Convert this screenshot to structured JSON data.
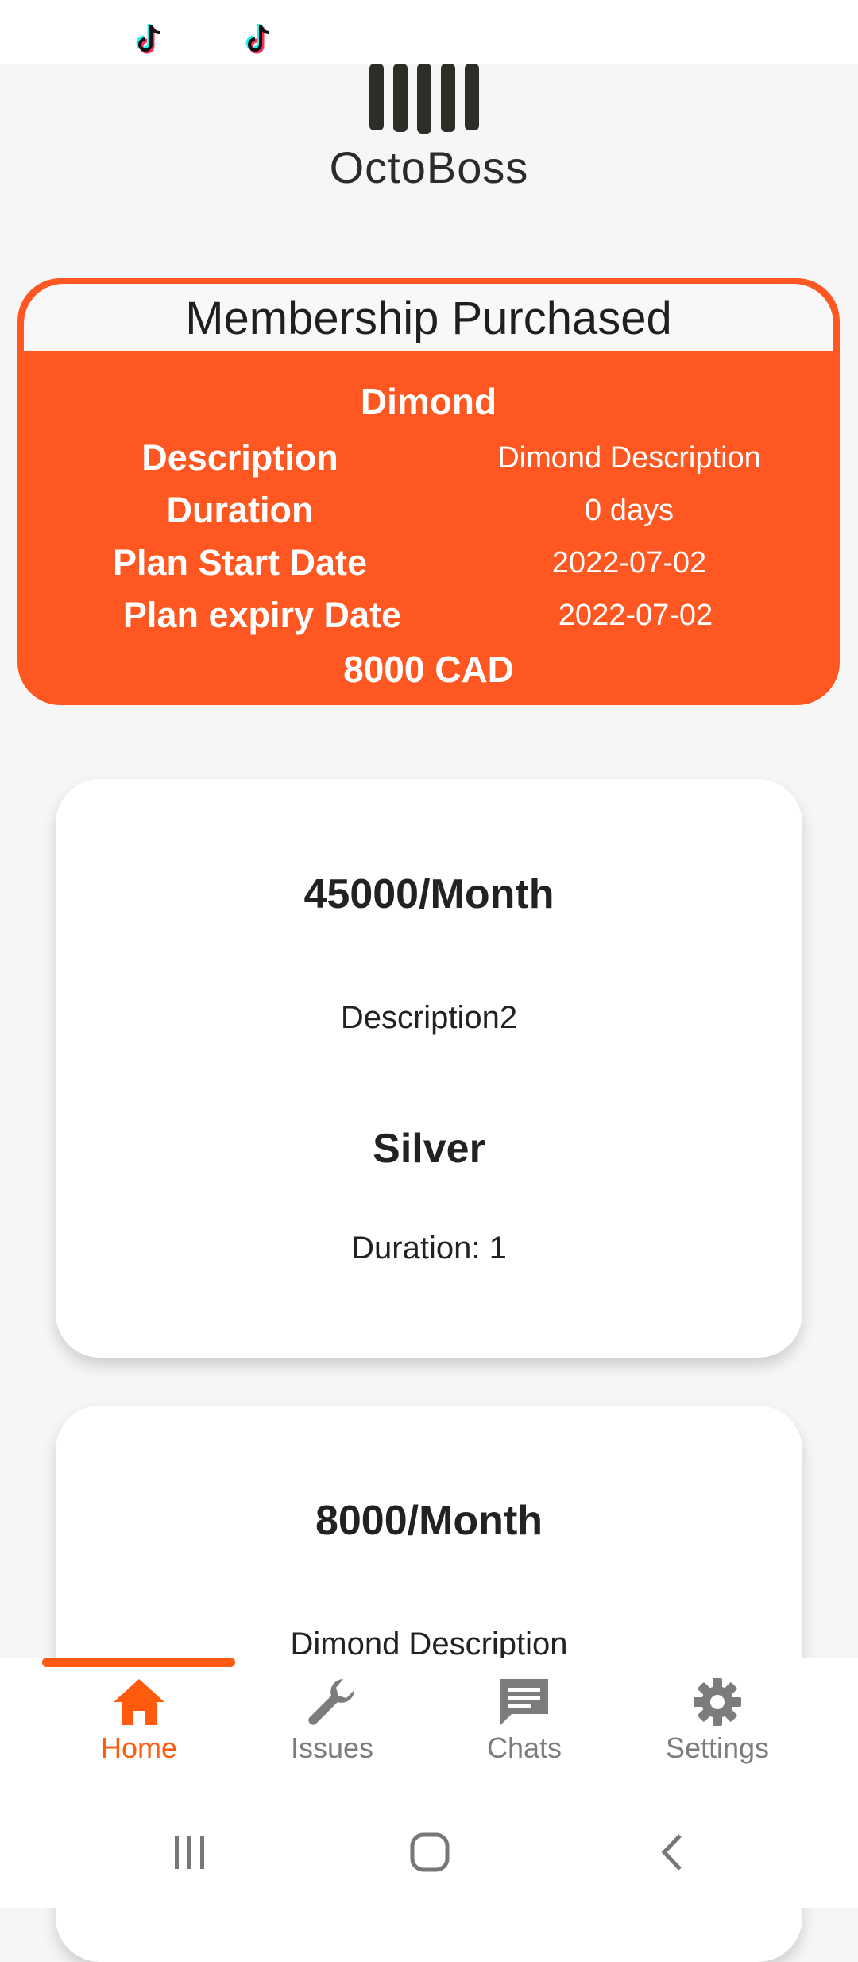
{
  "app": {
    "name": "OctoBoss"
  },
  "status_bar": {
    "icons": [
      "tiktok-icon",
      "tiktok-icon"
    ]
  },
  "membership": {
    "title": "Membership Purchased",
    "plan_name": "Dimond",
    "rows": [
      {
        "label": "Description",
        "value": "Dimond Description"
      },
      {
        "label": "Duration",
        "value": "0 days"
      },
      {
        "label": "Plan Start Date",
        "value": "2022-07-02"
      },
      {
        "label": "Plan expiry Date",
        "value": "2022-07-02"
      }
    ],
    "price": "8000 CAD"
  },
  "plans": [
    {
      "price": "45000/Month",
      "description": "Description2",
      "tier": "Silver",
      "duration": "Duration: 1"
    },
    {
      "price": "8000/Month",
      "description": "Dimond Description"
    }
  ],
  "bottom_nav": {
    "items": [
      {
        "label": "Home",
        "icon": "home-icon",
        "active": true
      },
      {
        "label": "Issues",
        "icon": "wrench-icon",
        "active": false
      },
      {
        "label": "Chats",
        "icon": "chat-icon",
        "active": false
      },
      {
        "label": "Settings",
        "icon": "gear-icon",
        "active": false
      }
    ]
  },
  "system_nav": {
    "icons": [
      "recent-apps-icon",
      "home-circle-icon",
      "back-icon"
    ]
  },
  "colors": {
    "accent": "#ff5722",
    "nav_active": "#ff5a0d",
    "nav_inactive": "#7c7c7c",
    "background": "#f6f6f6"
  }
}
